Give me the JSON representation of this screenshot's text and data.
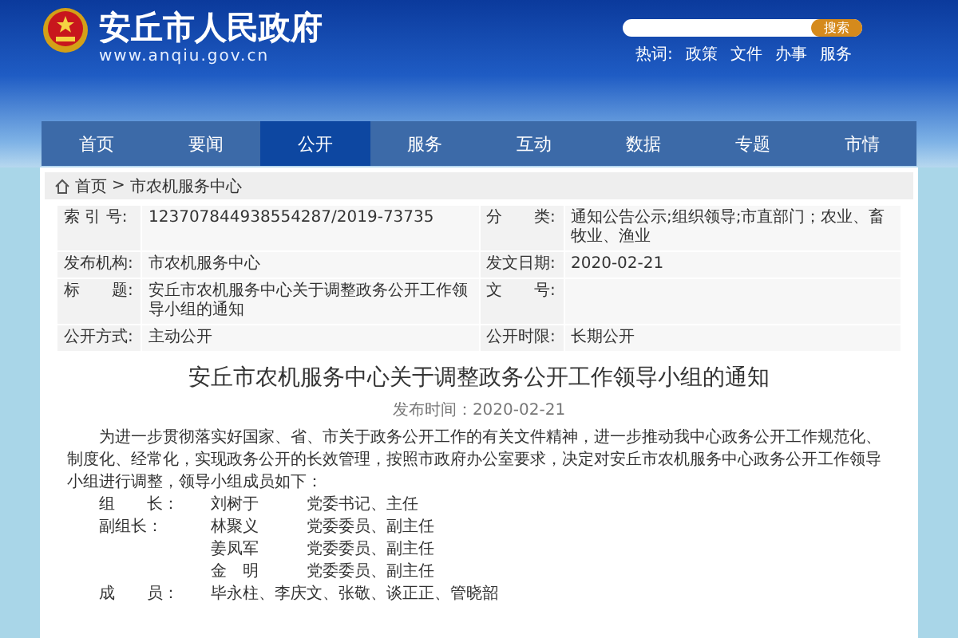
{
  "site": {
    "title": "安丘市人民政府",
    "url": "www.anqiu.gov.cn"
  },
  "search": {
    "button": "搜索",
    "hot_label": "热词:",
    "hot_words": [
      "政策",
      "文件",
      "办事",
      "服务"
    ]
  },
  "nav": [
    {
      "label": "首页",
      "selected": false
    },
    {
      "label": "要闻",
      "selected": false
    },
    {
      "label": "公开",
      "selected": true
    },
    {
      "label": "服务",
      "selected": false
    },
    {
      "label": "互动",
      "selected": false
    },
    {
      "label": "数据",
      "selected": false
    },
    {
      "label": "专题",
      "selected": false
    },
    {
      "label": "市情",
      "selected": false
    }
  ],
  "breadcrumb": [
    "首页",
    "市农机服务中心"
  ],
  "breadcrumb_separator": ">",
  "meta": [
    {
      "label": "索 引 号:",
      "value": "123707844938554287/2019-73735"
    },
    {
      "label": "分　　类:",
      "value": "通知公告公示;组织领导;市直部门；农业、畜牧业、渔业"
    },
    {
      "label": "发布机构:",
      "value": "市农机服务中心"
    },
    {
      "label": "发文日期:",
      "value": "2020-02-21"
    },
    {
      "label": "标　　题:",
      "value": "安丘市农机服务中心关于调整政务公开工作领导小组的通知"
    },
    {
      "label": "文　　号:"
    },
    {
      "label": "公开方式:",
      "value": "主动公开"
    },
    {
      "label": "公开时限:",
      "value": "长期公开"
    }
  ],
  "article": {
    "title": "安丘市农机服务中心关于调整政务公开工作领导小组的通知",
    "date": "发布时间：2020-02-21",
    "paragraph": "为进一步贯彻落实好国家、省、市关于政务公开工作的有关文件精神，进一步推动我中心政务公开工作规范化、制度化、经常化，实现政务公开的长效管理，按照市政府办公室要求，决定对安丘市农机服务中心政务公开工作领导小组进行调整，领导小组成员如下：",
    "members": [
      {
        "title": "组　　长：",
        "entries": [
          {
            "name": "刘树于",
            "duty": "党委书记、主任"
          }
        ]
      },
      {
        "title": "副组长：",
        "entries": [
          {
            "name": "林聚义",
            "duty": "党委委员、副主任"
          },
          {
            "name": "姜凤军",
            "duty": "党委委员、副主任"
          },
          {
            "name": "金　明",
            "duty": "党委委员、副主任"
          }
        ]
      },
      {
        "title": "成　　员：",
        "entries": [
          {
            "name": "毕永柱、李庆文、张敬、谈正正、管晓韶"
          }
        ]
      }
    ]
  }
}
